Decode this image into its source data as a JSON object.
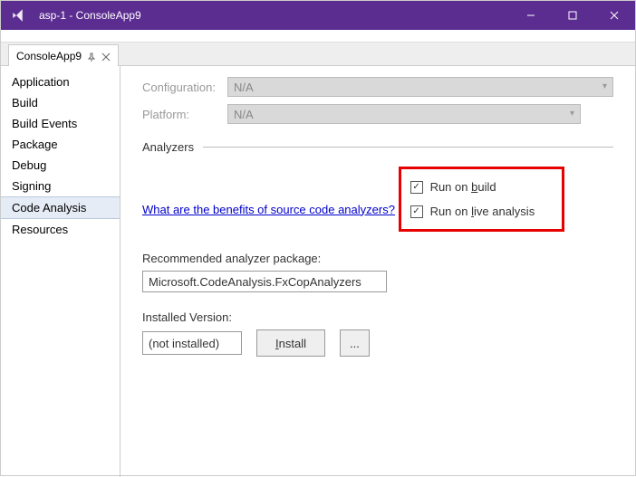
{
  "window": {
    "title": "asp-1 - ConsoleApp9"
  },
  "tab": {
    "label": "ConsoleApp9"
  },
  "sidebar": {
    "items": [
      {
        "label": "Application"
      },
      {
        "label": "Build"
      },
      {
        "label": "Build Events"
      },
      {
        "label": "Package"
      },
      {
        "label": "Debug"
      },
      {
        "label": "Signing"
      },
      {
        "label": "Code Analysis"
      },
      {
        "label": "Resources"
      }
    ],
    "selected_index": 6
  },
  "config": {
    "configuration_label": "Configuration:",
    "configuration_value": "N/A",
    "platform_label": "Platform:",
    "platform_value": "N/A"
  },
  "section": {
    "heading": "Analyzers",
    "help_link": "What are the benefits of source code analyzers?"
  },
  "checkboxes": {
    "run_build_pre": "Run on ",
    "run_build_u": "b",
    "run_build_post": "uild",
    "run_live_pre": "Run on ",
    "run_live_u": "l",
    "run_live_post": "ive analysis",
    "run_build_checked": true,
    "run_live_checked": true
  },
  "recommended": {
    "label": "Recommended analyzer package:",
    "value": "Microsoft.CodeAnalysis.FxCopAnalyzers"
  },
  "installed": {
    "label": "Installed Version:",
    "value": "(not installed)",
    "install_btn_pre": "",
    "install_btn_u": "I",
    "install_btn_post": "nstall",
    "browse_btn": "..."
  },
  "check_mark": "✓"
}
